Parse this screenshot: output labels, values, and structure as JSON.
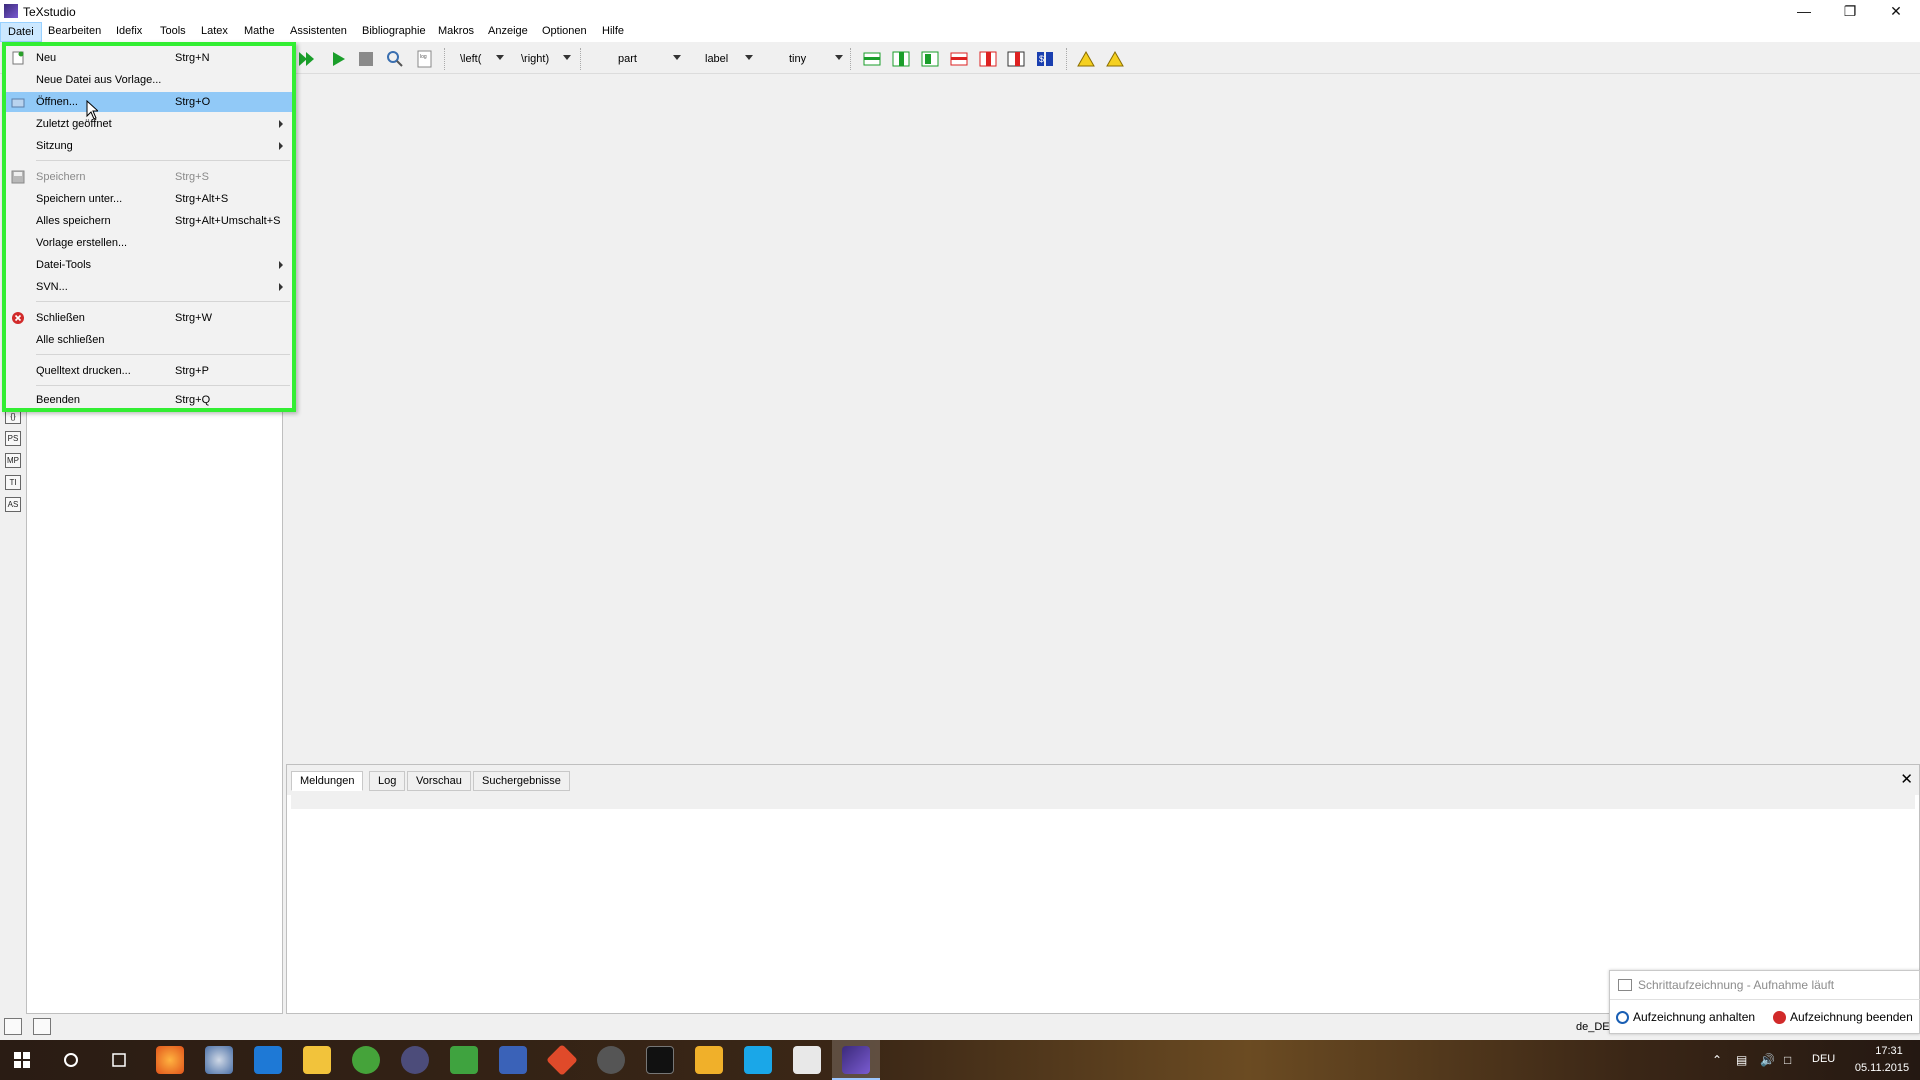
{
  "window": {
    "title": "TeXstudio"
  },
  "menubar": [
    {
      "label": "Datei"
    },
    {
      "label": "Bearbeiten"
    },
    {
      "label": "Idefix"
    },
    {
      "label": "Tools"
    },
    {
      "label": "Latex"
    },
    {
      "label": "Mathe"
    },
    {
      "label": "Assistenten"
    },
    {
      "label": "Bibliographie"
    },
    {
      "label": "Makros"
    },
    {
      "label": "Anzeige"
    },
    {
      "label": "Optionen"
    },
    {
      "label": "Hilfe"
    }
  ],
  "toolbar": {
    "left_combo": "\\left(",
    "right_combo": "\\right)",
    "section_combo": "part",
    "ref_combo": "label",
    "size_combo": "tiny"
  },
  "datei_menu": {
    "items": [
      {
        "label": "Neu",
        "shortcut": "Strg+N"
      },
      {
        "label": "Neue Datei aus Vorlage...",
        "shortcut": ""
      },
      {
        "label": "Öffnen...",
        "shortcut": "Strg+O"
      },
      {
        "label": "Zuletzt geöffnet",
        "shortcut": ""
      },
      {
        "label": "Sitzung",
        "shortcut": ""
      },
      {
        "label": "Speichern",
        "shortcut": "Strg+S"
      },
      {
        "label": "Speichern unter...",
        "shortcut": "Strg+Alt+S"
      },
      {
        "label": "Alles speichern",
        "shortcut": "Strg+Alt+Umschalt+S"
      },
      {
        "label": "Vorlage erstellen...",
        "shortcut": ""
      },
      {
        "label": "Datei-Tools",
        "shortcut": ""
      },
      {
        "label": "SVN...",
        "shortcut": ""
      },
      {
        "label": "Schließen",
        "shortcut": "Strg+W"
      },
      {
        "label": "Alle schließen",
        "shortcut": ""
      },
      {
        "label": "Quelltext drucken...",
        "shortcut": "Strg+P"
      },
      {
        "label": "Beenden",
        "shortcut": "Strg+Q"
      }
    ]
  },
  "side_icons": [
    "{}",
    "PS",
    "MP",
    "TI",
    "AS"
  ],
  "bottom_panel": {
    "tabs": [
      {
        "label": "Meldungen"
      },
      {
        "label": "Log"
      },
      {
        "label": "Vorschau"
      },
      {
        "label": "Suchergebnisse"
      }
    ],
    "active_tab": "Meldungen"
  },
  "statusbar": {
    "language": "de_DE"
  },
  "recorder": {
    "title": "Schrittaufzeichnung - Aufnahme läuft",
    "pause_label": "Aufzeichnung anhalten",
    "stop_label": "Aufzeichnung beenden"
  },
  "taskbar": {
    "language": "DEU",
    "time": "17:31",
    "date": "05.11.2015"
  },
  "colors": {
    "menu_highlight": "#91c9f7",
    "menu_outline": "#33ee33",
    "active_menu": "#cce8ff"
  }
}
